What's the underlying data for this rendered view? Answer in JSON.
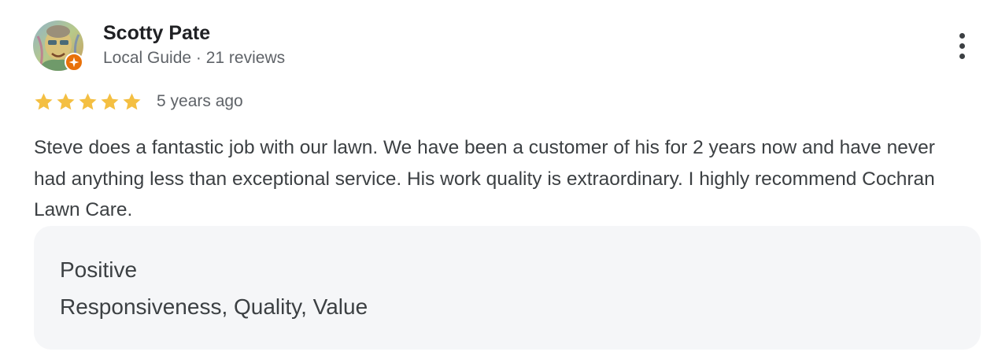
{
  "review": {
    "author": {
      "name": "Scotty Pate",
      "meta": "Local Guide · 21 reviews",
      "avatar_icon": "avatar-photo",
      "badge_icon": "local-guide-star-icon",
      "badge_color": "#e8710a"
    },
    "more_options_icon": "more-vert-icon",
    "rating": {
      "stars": 5,
      "max_stars": 5,
      "star_color": "#f4bf42",
      "star_icon": "star-icon"
    },
    "date": "5 years ago",
    "text": "Steve does a fantastic job with our lawn. We have been a customer of his for 2 years now and have never had anything less than exceptional service. His work quality is extraordinary. I highly recommend Cochran Lawn Care.",
    "highlights": {
      "title": "Positive",
      "values": "Responsiveness, Quality, Value"
    }
  }
}
